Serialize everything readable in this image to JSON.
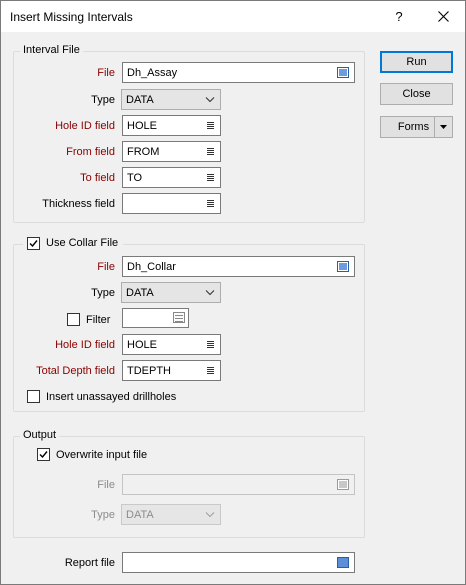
{
  "window": {
    "title": "Insert Missing Intervals",
    "help_label": "?",
    "close_icon": "close-icon"
  },
  "interval_file": {
    "group_label": "Interval File",
    "file_label": "File",
    "file_value": "Dh_Assay",
    "type_label": "Type",
    "type_value": "DATA",
    "hole_id_label": "Hole ID field",
    "hole_id_value": "HOLE",
    "from_label": "From field",
    "from_value": "FROM",
    "to_label": "To field",
    "to_value": "TO",
    "thickness_label": "Thickness field",
    "thickness_value": ""
  },
  "collar": {
    "use_collar_label": "Use Collar File",
    "use_collar_checked": true,
    "file_label": "File",
    "file_value": "Dh_Collar",
    "type_label": "Type",
    "type_value": "DATA",
    "filter_label": "Filter",
    "filter_checked": false,
    "filter_value": "",
    "hole_id_label": "Hole ID field",
    "hole_id_value": "HOLE",
    "total_depth_label": "Total Depth field",
    "total_depth_value": "TDEPTH",
    "insert_unassayed_label": "Insert unassayed drillholes",
    "insert_unassayed_checked": false
  },
  "output": {
    "group_label": "Output",
    "overwrite_label": "Overwrite input file",
    "overwrite_checked": true,
    "file_label": "File",
    "file_value": "",
    "type_label": "Type",
    "type_value": "DATA"
  },
  "report": {
    "label": "Report file",
    "value": ""
  },
  "buttons": {
    "run": "Run",
    "close": "Close",
    "forms": "Forms"
  },
  "colors": {
    "required_label": "#8b0000",
    "accent": "#0078d7"
  }
}
